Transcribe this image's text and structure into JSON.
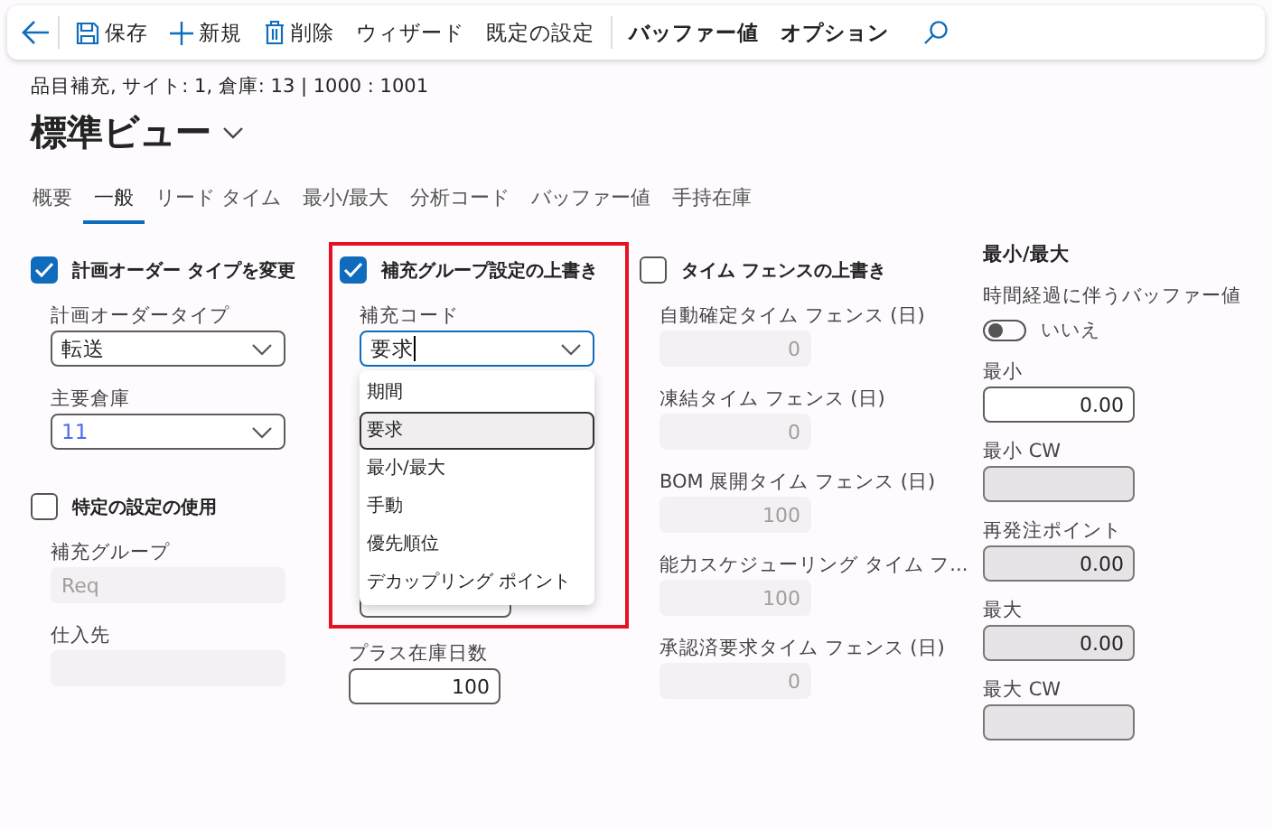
{
  "toolbar": {
    "items": [
      {
        "label": "保存",
        "bold": false
      },
      {
        "label": "新規",
        "bold": false
      },
      {
        "label": "削除",
        "bold": false
      },
      {
        "label": "ウィザード",
        "bold": false
      },
      {
        "label": "既定の設定",
        "bold": false
      },
      {
        "label": "バッファー値",
        "bold": true
      },
      {
        "label": "オプション",
        "bold": true
      }
    ]
  },
  "breadcrumb": "品目補充, サイト: 1, 倉庫: 13  |  1000 : 1001",
  "title": "標準ビュー",
  "tabs": [
    {
      "label": "概要",
      "selected": false
    },
    {
      "label": "一般",
      "selected": true
    },
    {
      "label": "リード タイム",
      "selected": false
    },
    {
      "label": "最小/最大",
      "selected": false
    },
    {
      "label": "分析コード",
      "selected": false
    },
    {
      "label": "バッファー値",
      "selected": false
    },
    {
      "label": "手持在庫",
      "selected": false
    }
  ],
  "columns": [
    {
      "highlighted": false,
      "items": [
        {
          "kind": "checkbox",
          "label": "計画オーダー タイプを変更",
          "checked": true
        },
        {
          "kind": "select",
          "label": "計画オーダータイプ",
          "value": "転送"
        },
        {
          "kind": "select",
          "label": "主要倉庫",
          "value": "11"
        },
        {
          "kind": "checkbox",
          "label": "特定の設定の使用",
          "checked": false
        },
        {
          "kind": "input",
          "label": "補充グループ",
          "value": "Req",
          "disabled": true
        },
        {
          "kind": "input",
          "label": "仕入先",
          "disabled": true
        }
      ]
    },
    {
      "highlighted": true,
      "items": [
        {
          "kind": "checkbox",
          "label": "補充グループ設定の上書き",
          "checked": true
        },
        {
          "kind": "select",
          "label": "補充コード",
          "value": "要求",
          "focused": true,
          "options": [
            {
              "label": "期間",
              "selected": false
            },
            {
              "label": "要求",
              "selected": true
            },
            {
              "label": "最小/最大",
              "selected": false
            },
            {
              "label": "手動",
              "selected": false
            },
            {
              "label": "優先順位",
              "selected": false
            },
            {
              "label": "デカップリング ポイント",
              "selected": false
            }
          ]
        },
        {
          "kind": "input"
        }
      ],
      "below": [
        {
          "kind": "input",
          "label": "プラス在庫日数",
          "value": "100",
          "disabled": false,
          "readonly": false
        }
      ]
    },
    {
      "highlighted": false,
      "items": [
        {
          "kind": "checkbox",
          "label": "タイム フェンスの上書き",
          "checked": false
        },
        {
          "kind": "input",
          "label": "自動確定タイム フェンス (日)",
          "value": "0",
          "disabled": true
        },
        {
          "kind": "input",
          "label": "凍結タイム フェンス (日)",
          "value": "0",
          "disabled": true
        },
        {
          "kind": "input",
          "label": "BOM 展開タイム フェンス (日)",
          "value": "100",
          "disabled": true
        },
        {
          "kind": "input",
          "label": "能力スケジューリング タイム フ...",
          "value": "100",
          "disabled": true
        },
        {
          "kind": "input",
          "label": "承認済要求タイム フェンス (日)",
          "value": "0",
          "disabled": true
        }
      ]
    },
    {
      "highlighted": false,
      "items": [
        {
          "kind": "heading",
          "label": "最小/最大"
        },
        {
          "kind": "toggle",
          "label": "時間経過に伴うバッファー値",
          "on": false,
          "text": "いいえ"
        },
        {
          "kind": "input",
          "label": "最小",
          "value": "0.00",
          "disabled": false,
          "readonly": false
        },
        {
          "kind": "input",
          "label": "最小 CW",
          "disabled": false,
          "readonly": true
        },
        {
          "kind": "input",
          "label": "再発注ポイント",
          "value": "0.00",
          "disabled": false,
          "readonly": true
        },
        {
          "kind": "input",
          "label": "最大",
          "value": "0.00",
          "disabled": false,
          "readonly": true
        },
        {
          "kind": "input",
          "label": "最大 CW",
          "disabled": false,
          "readonly": true
        }
      ]
    }
  ]
}
